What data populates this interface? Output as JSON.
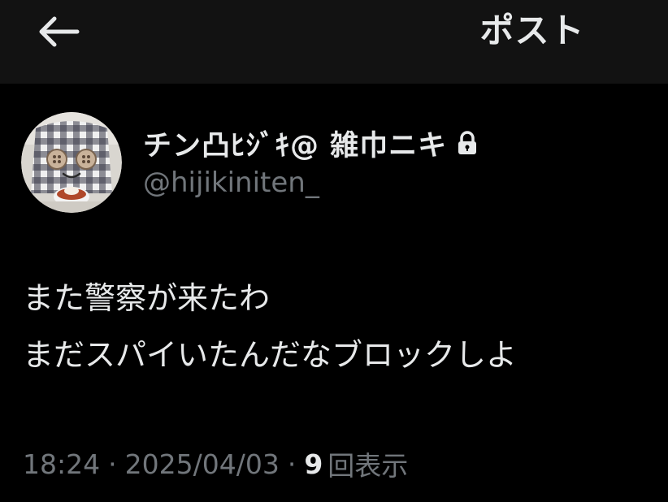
{
  "header": {
    "title": "ポスト",
    "back_icon": "back-arrow-icon"
  },
  "author": {
    "display_name": "チン凸ﾋｼﾞｷ@ 雑巾ニキ",
    "handle": "@hijikiniten_",
    "protected_icon": "lock-icon"
  },
  "tweet": {
    "lines": [
      "また警察が来たわ",
      "まだスパイいたんだなブロックしよ"
    ]
  },
  "meta": {
    "time": "18:24",
    "separator": "·",
    "date": "2025/04/03",
    "views_count": "9",
    "views_label": "回表示"
  },
  "colors": {
    "background": "#000000",
    "header_background": "#121212",
    "primary_text": "#e7e9ea",
    "secondary_text": "#71767b"
  }
}
